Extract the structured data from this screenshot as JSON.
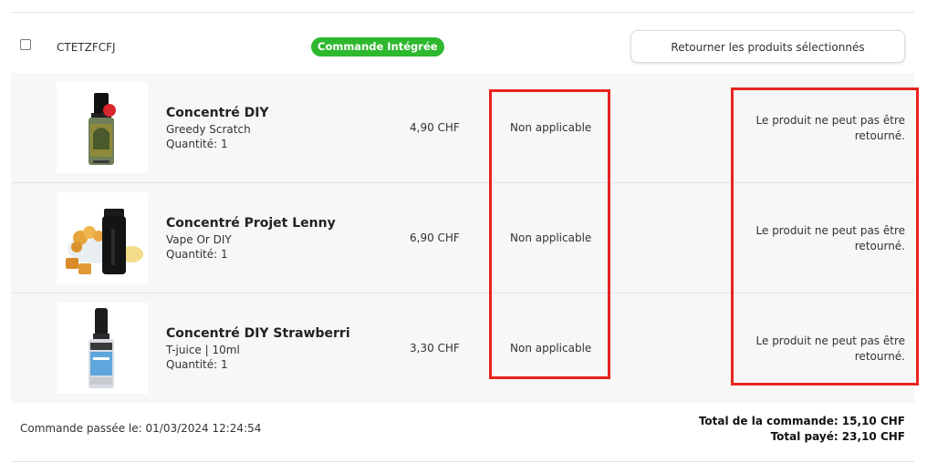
{
  "order": {
    "id": "CTETZFCFJ",
    "badge": "Commande Intégrée",
    "return_button_label": "Retourner les produits sélectionnés"
  },
  "products": [
    {
      "name": "Concentré DIY",
      "variant": "Greedy Scratch",
      "quantity": "Quantité: 1",
      "price": "4,90 CHF",
      "status": "Non applicable",
      "note": "Le produit ne peut pas être retourné.",
      "image_icon": "e-liquid-bottle-red-cap"
    },
    {
      "name": "Concentré Projet Lenny",
      "variant": "Vape Or DIY",
      "quantity": "Quantité: 1",
      "price": "6,90 CHF",
      "status": "Non applicable",
      "note": "Le produit ne peut pas être retourné.",
      "image_icon": "black-bottle-with-caramel-snacks"
    },
    {
      "name": "Concentré DIY Strawberri",
      "variant": "T-juice | 10ml",
      "quantity": "Quantité: 1",
      "price": "3,30 CHF",
      "status": "Non applicable",
      "note": "Le produit ne peut pas être retourné.",
      "image_icon": "e-liquid-bottle-black-cap"
    }
  ],
  "footer": {
    "order_date": "Commande passée le: 01/03/2024 12:24:54",
    "total_order": "Total de la commande: 15,10 CHF",
    "total_paid": "Total payé: 23,10 CHF"
  },
  "colors": {
    "badge_green": "#2eb82e",
    "highlight_red": "#e8231e",
    "row_background": "#f7f7f7"
  }
}
